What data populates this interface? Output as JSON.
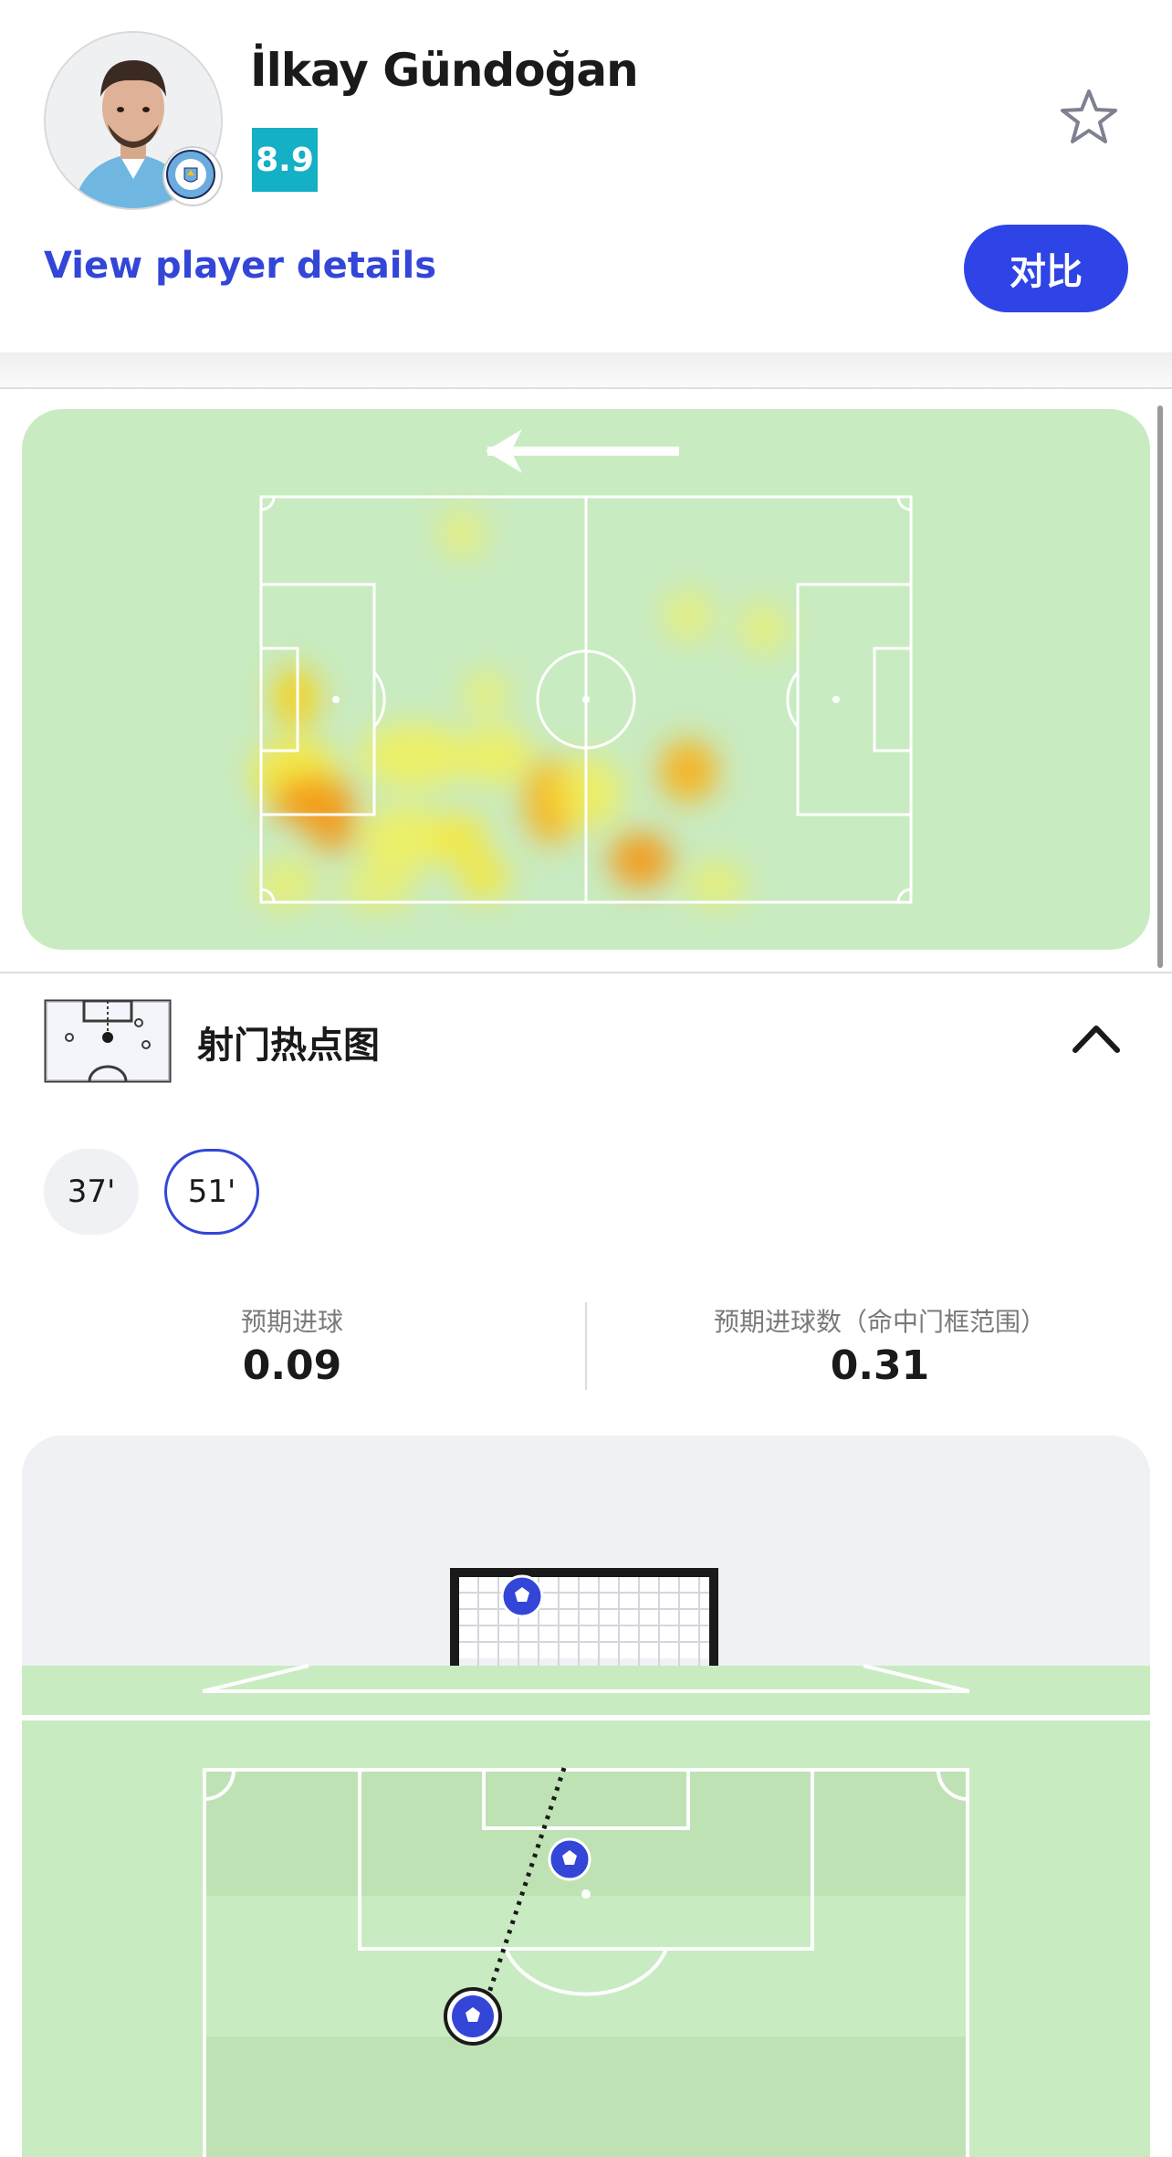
{
  "player": {
    "name": "İlkay Gündoğan",
    "rating": "8.9",
    "details_link": "View player details",
    "compare_label": "对比"
  },
  "icons": {
    "avatar": "player-photo",
    "club": "manchester-city-badge",
    "favorite": "star-outline-icon",
    "attack_direction": "arrow-left-icon",
    "shotmap": "shot-map-icon",
    "collapse": "chevron-up-icon",
    "ball": "soccer-ball-icon"
  },
  "colors": {
    "accent": "#2f44e6",
    "rating_bg": "#13b0c6",
    "pitch": "#c9ebc1",
    "heat_low": "#f7f04a",
    "heat_high": "#f28c14"
  },
  "shotmap": {
    "title": "射门热点图",
    "shots": [
      {
        "minute_label": "37'",
        "selected": false
      },
      {
        "minute_label": "51'",
        "selected": true
      }
    ],
    "stats": [
      {
        "label": "预期进球",
        "value": "0.09"
      },
      {
        "label": "预期进球数（命中门框范围）",
        "value": "0.31"
      }
    ]
  }
}
